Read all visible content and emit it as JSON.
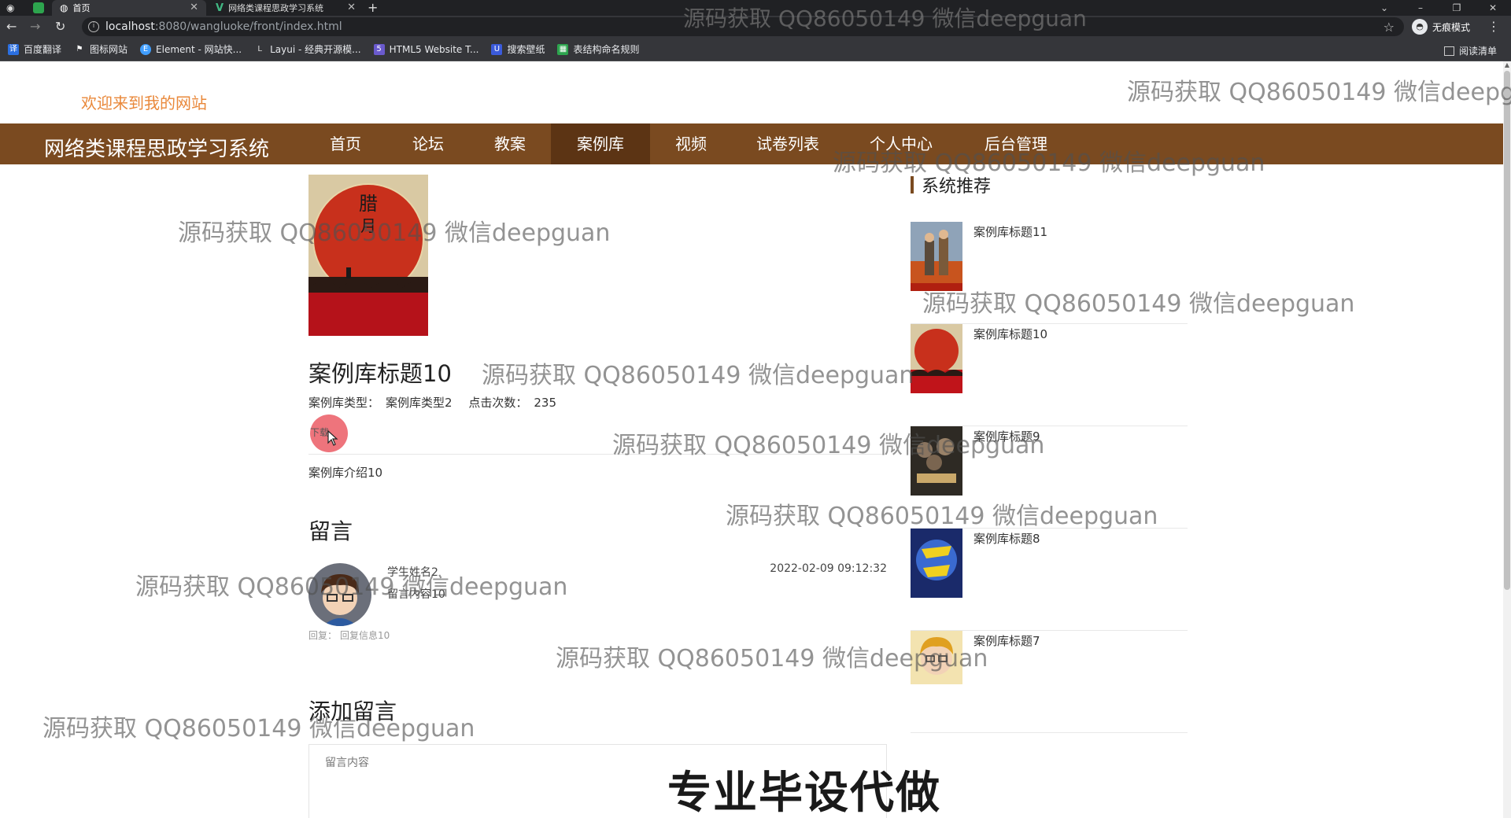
{
  "browser": {
    "tabs": [
      {
        "label": "首页",
        "active": true
      },
      {
        "label": "网络类课程思政学习系统",
        "active": false
      }
    ],
    "url_host": "localhost",
    "url_rest": ":8080/wangluoke/front/index.html",
    "incognito_label": "无痕模式",
    "bookmarks": [
      "百度翻译",
      "图标网站",
      "Element - 网站快...",
      "Layui - 经典开源模...",
      "HTML5 Website T...",
      "搜索壁纸",
      "表结构命名规则"
    ],
    "reading_list": "阅读清单"
  },
  "site": {
    "welcome": "欢迎来到我的网站",
    "brand": "网络类课程思政学习系统",
    "nav": [
      "首页",
      "论坛",
      "教案",
      "案例库",
      "视频",
      "试卷列表",
      "个人中心",
      "后台管理"
    ],
    "active_nav": "案例库"
  },
  "detail": {
    "title": "案例库标题10",
    "type_label": "案例库类型：",
    "type_value": "案例库类型2",
    "clicks_label": "点击次数：",
    "clicks_value": "235",
    "download_label": "下载",
    "intro": "案例库介绍10"
  },
  "messages": {
    "heading": "留言",
    "items": [
      {
        "name": "学生姓名2",
        "content": "留言内容10",
        "time": "2022-02-09 09:12:32",
        "reply_label": "回复：",
        "reply": "回复信息10"
      }
    ]
  },
  "add_message": {
    "heading": "添加留言",
    "placeholder": "留言内容"
  },
  "recommend": {
    "heading": "系统推荐",
    "items": [
      "案例库标题11",
      "案例库标题10",
      "案例库标题9",
      "案例库标题8",
      "案例库标题7"
    ]
  },
  "watermark_text": "源码获取 QQ86050149 微信deepguan",
  "stamp_text": "专业毕设代做",
  "colors": {
    "nav_bg": "#7a4a20",
    "nav_active": "#5c3414",
    "welcome": "#e9883a",
    "poster_red": "#c0141a"
  }
}
